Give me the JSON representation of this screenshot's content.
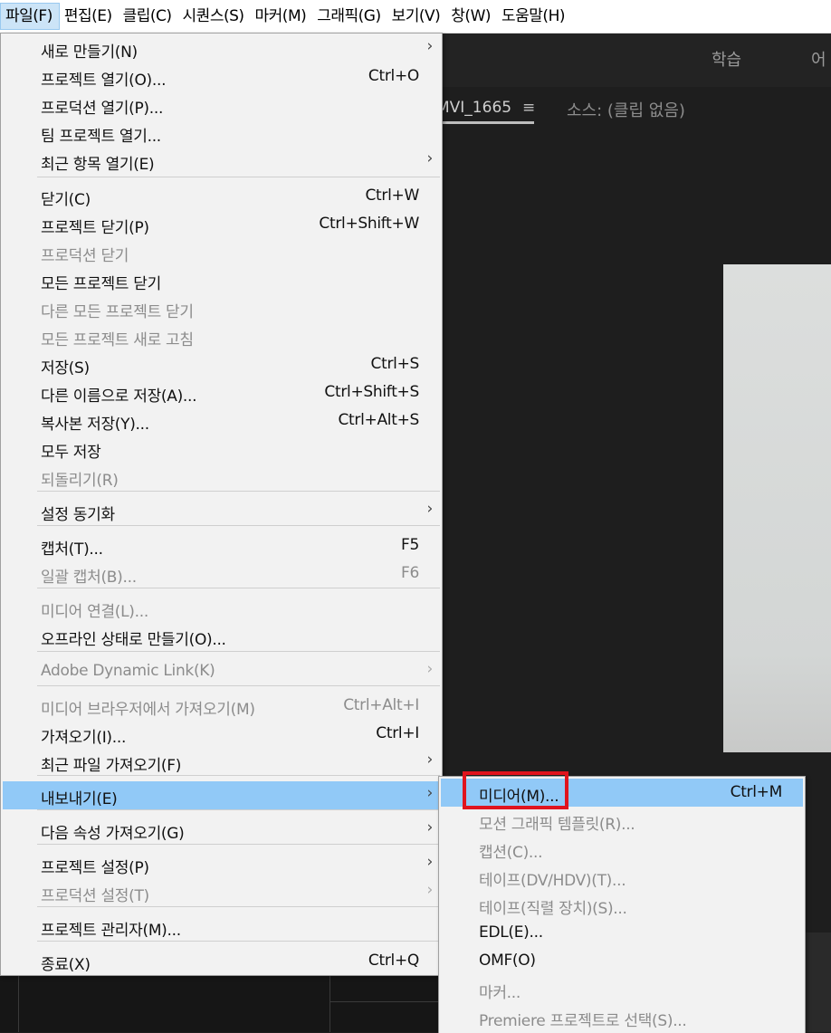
{
  "menubar": {
    "items": [
      "파일(F)",
      "편집(E)",
      "클립(C)",
      "시퀀스(S)",
      "마커(M)",
      "그래픽(G)",
      "보기(V)",
      "창(W)",
      "도움말(H)"
    ]
  },
  "workspace": {
    "tab_learn": "학습",
    "tab_partial": "어"
  },
  "panel": {
    "clip_tab": "MVI_1665",
    "menu_glyph": "≡",
    "source_tab": "소스: (클립 없음)"
  },
  "file_menu": [
    {
      "label": "새로 만들기(N)",
      "shortcut": "",
      "submenu": true,
      "disabled": false
    },
    {
      "label": "프로젝트 열기(O)...",
      "shortcut": "Ctrl+O",
      "submenu": false,
      "disabled": false
    },
    {
      "label": "프로덕션 열기(P)...",
      "shortcut": "",
      "submenu": false,
      "disabled": false
    },
    {
      "label": "팀 프로젝트 열기...",
      "shortcut": "",
      "submenu": false,
      "disabled": false
    },
    {
      "label": "최근 항목 열기(E)",
      "shortcut": "",
      "submenu": true,
      "disabled": false
    },
    {
      "label": "닫기(C)",
      "shortcut": "Ctrl+W",
      "submenu": false,
      "disabled": false
    },
    {
      "label": "프로젝트 닫기(P)",
      "shortcut": "Ctrl+Shift+W",
      "submenu": false,
      "disabled": false
    },
    {
      "label": "프로덕션 닫기",
      "shortcut": "",
      "submenu": false,
      "disabled": true
    },
    {
      "label": "모든 프로젝트 닫기",
      "shortcut": "",
      "submenu": false,
      "disabled": false
    },
    {
      "label": "다른 모든 프로젝트 닫기",
      "shortcut": "",
      "submenu": false,
      "disabled": true
    },
    {
      "label": "모든 프로젝트 새로 고침",
      "shortcut": "",
      "submenu": false,
      "disabled": true
    },
    {
      "label": "저장(S)",
      "shortcut": "Ctrl+S",
      "submenu": false,
      "disabled": false
    },
    {
      "label": "다른 이름으로 저장(A)...",
      "shortcut": "Ctrl+Shift+S",
      "submenu": false,
      "disabled": false
    },
    {
      "label": "복사본 저장(Y)...",
      "shortcut": "Ctrl+Alt+S",
      "submenu": false,
      "disabled": false
    },
    {
      "label": "모두 저장",
      "shortcut": "",
      "submenu": false,
      "disabled": false
    },
    {
      "label": "되돌리기(R)",
      "shortcut": "",
      "submenu": false,
      "disabled": true
    },
    {
      "label": "설정 동기화",
      "shortcut": "",
      "submenu": true,
      "disabled": false
    },
    {
      "label": "캡처(T)...",
      "shortcut": "F5",
      "submenu": false,
      "disabled": false
    },
    {
      "label": "일괄 캡처(B)...",
      "shortcut": "F6",
      "submenu": false,
      "disabled": true
    },
    {
      "label": "미디어 연결(L)...",
      "shortcut": "",
      "submenu": false,
      "disabled": true
    },
    {
      "label": "오프라인 상태로 만들기(O)...",
      "shortcut": "",
      "submenu": false,
      "disabled": false
    },
    {
      "label": "Adobe Dynamic Link(K)",
      "shortcut": "",
      "submenu": true,
      "disabled": true
    },
    {
      "label": "미디어 브라우저에서 가져오기(M)",
      "shortcut": "Ctrl+Alt+I",
      "submenu": false,
      "disabled": true
    },
    {
      "label": "가져오기(I)...",
      "shortcut": "Ctrl+I",
      "submenu": false,
      "disabled": false
    },
    {
      "label": "최근 파일 가져오기(F)",
      "shortcut": "",
      "submenu": true,
      "disabled": false
    },
    {
      "label": "내보내기(E)",
      "shortcut": "",
      "submenu": true,
      "disabled": false,
      "highlighted": true
    },
    {
      "label": "다음 속성 가져오기(G)",
      "shortcut": "",
      "submenu": true,
      "disabled": false
    },
    {
      "label": "프로젝트 설정(P)",
      "shortcut": "",
      "submenu": true,
      "disabled": false
    },
    {
      "label": "프로덕션 설정(T)",
      "shortcut": "",
      "submenu": true,
      "disabled": true
    },
    {
      "label": "프로젝트 관리자(M)...",
      "shortcut": "",
      "submenu": false,
      "disabled": false
    },
    {
      "label": "종료(X)",
      "shortcut": "Ctrl+Q",
      "submenu": false,
      "disabled": false
    }
  ],
  "export_menu": [
    {
      "label": "미디어(M)...",
      "shortcut": "Ctrl+M",
      "disabled": false,
      "highlighted": true
    },
    {
      "label": "모션 그래픽 템플릿(R)...",
      "shortcut": "",
      "disabled": true
    },
    {
      "label": "캡션(C)...",
      "shortcut": "",
      "disabled": true
    },
    {
      "label": "테이프(DV/HDV)(T)...",
      "shortcut": "",
      "disabled": true
    },
    {
      "label": "테이프(직렬 장치)(S)...",
      "shortcut": "",
      "disabled": true
    },
    {
      "label": "EDL(E)...",
      "shortcut": "",
      "disabled": false
    },
    {
      "label": "OMF(O)",
      "shortcut": "",
      "disabled": false
    },
    {
      "label": "마커...",
      "shortcut": "",
      "disabled": true
    },
    {
      "label": "Premiere 프로젝트로 선택(S)...",
      "shortcut": "",
      "disabled": true
    }
  ],
  "colors": {
    "highlight": "#91c9f7",
    "annotation_box": "#e0141e"
  }
}
